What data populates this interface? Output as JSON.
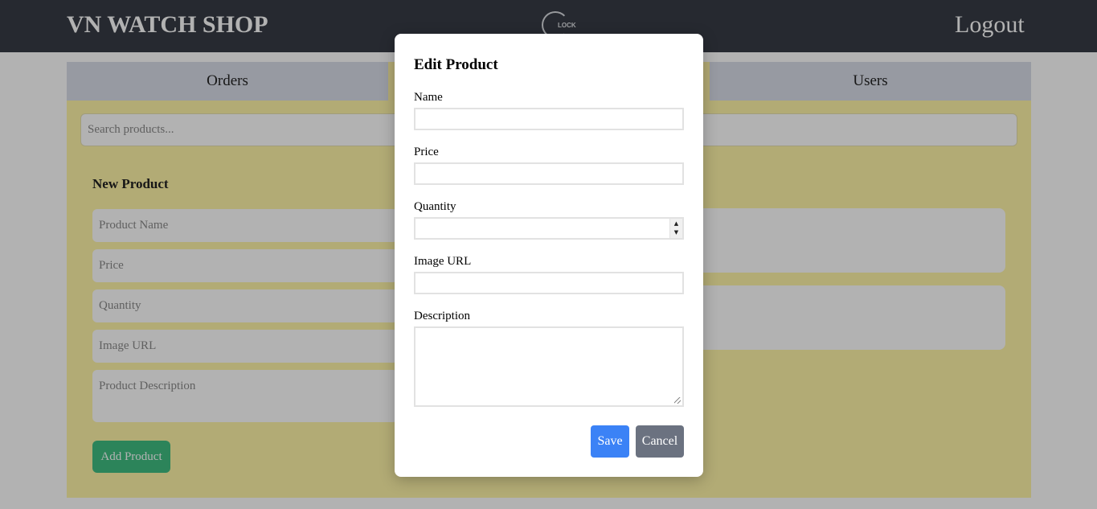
{
  "header": {
    "brand": "VN WATCH SHOP",
    "logo_text": "LOCK",
    "logout": "Logout"
  },
  "tabs": [
    {
      "label": "Orders"
    },
    {
      "label": ""
    },
    {
      "label": "Users"
    }
  ],
  "search": {
    "placeholder": "Search products..."
  },
  "new_product": {
    "title": "New Product",
    "fields": [
      {
        "placeholder": "Product Name"
      },
      {
        "placeholder": "Price"
      },
      {
        "placeholder": "Quantity"
      },
      {
        "placeholder": "Image URL"
      },
      {
        "placeholder": "Product Description"
      }
    ],
    "add_label": "Add Product"
  },
  "modal": {
    "title": "Edit Product",
    "labels": {
      "name": "Name",
      "price": "Price",
      "quantity": "Quantity",
      "image_url": "Image URL",
      "description": "Description"
    },
    "values": {
      "name": "",
      "price": "",
      "quantity": "",
      "image_url": "",
      "description": ""
    },
    "save_label": "Save",
    "cancel_label": "Cancel"
  },
  "colors": {
    "header_bg": "#373b45",
    "panel_bg": "#fff5a8",
    "save": "#3b82f6",
    "cancel": "#6b7280",
    "add": "#3fbd82"
  }
}
